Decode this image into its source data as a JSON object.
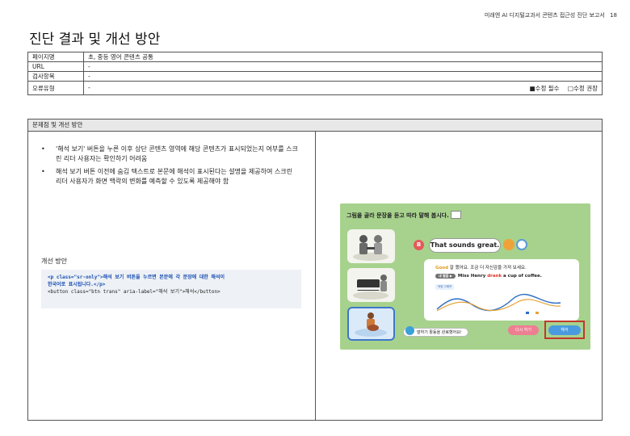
{
  "header": {
    "doc_title": "미래엔 AI 디지털교과서 콘텐츠 접근성 진단 보고서",
    "page_number": "18"
  },
  "page_title": "진단 결과 및 개선 방안",
  "info": {
    "rows": [
      {
        "key": "페이지명",
        "value": "초, 중등 영어 콘텐츠 공통"
      },
      {
        "key": "URL",
        "value": "-"
      },
      {
        "key": "검사항목",
        "value": "-"
      },
      {
        "key": "오류유형",
        "value": "-"
      }
    ],
    "legend_required": "■수정 필수",
    "legend_recommended": "□수정 권장"
  },
  "panel": {
    "heading": "문제점 및 개선 방안",
    "bullets": [
      "'해석 보기' 버튼을 누른 이후 상단 콘텐츠 영역에 해당 콘텐츠가 표시되었는지 여부를 스크린 리더 사용자는 확인하기 어려움",
      "해석 보기 버튼 이전에 숨김 텍스트로 본문에 해석이 표시된다는 설명을 제공하여 스크린 리더 사용자가 화면 맥락의 변화를 예측할 수 있도록 제공해야 함"
    ],
    "improvement_label": "개선 방안",
    "code_line1": "<p class=\"sr-only\">해석 보기 버튼을 누르면 본문에 각 문장에 대한 해석이",
    "code_line2": "한국어로 표시됩니다.</p>",
    "code_line3": "<button class=\"btn trans\" aria-label=\"해석 보기\">해석</button>"
  },
  "screenshot": {
    "title": "그림을 골라 문장을 듣고 따라 말해 봅시다.",
    "badge": "B",
    "sentence": "That sounds great.",
    "feedback_good": "Good",
    "feedback_rest": " 잘 했어요. 조금 더 자신감을 가져 보세요.",
    "my_voice_tag": "내 발음 ▶",
    "answer_pre": "Miss Henry ",
    "answer_red": "drank",
    "answer_post": " a cup of coffee.",
    "graph_tag": "억양 그래프",
    "done_label": "말하기 활동을 완료했어요!",
    "retry_button": "다시 하기",
    "translate_button": "해석",
    "colors": {
      "accent_highlight": "#c0392b",
      "background": "#a7d28d"
    }
  }
}
